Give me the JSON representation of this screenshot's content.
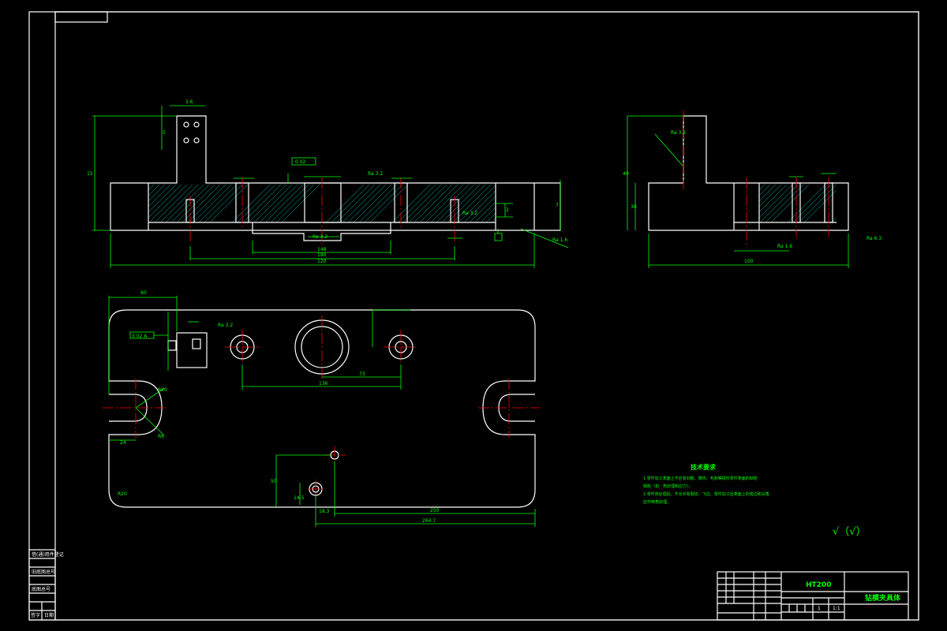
{
  "front_view": {
    "dim_width": "1.6",
    "dim_height": "15",
    "dim_left": "5",
    "dim_right": "7",
    "dim_total_top": "120",
    "dim_center_bottom": "180",
    "dim_mid_bottom": "148",
    "dim_gap": "2",
    "roughness_labels": [
      "Ra 3.2",
      "Ra 3.2",
      "Ra 3.2",
      "Ra 1.6"
    ],
    "tolerance_frame": "0.02"
  },
  "side_view": {
    "dim_total": "100",
    "dim_height": "40",
    "dim_depth": "30",
    "roughness_labels": [
      "Ra 1.6",
      "Ra 3.2",
      "Ra 6.3"
    ]
  },
  "plan_view": {
    "dim_top_left": "60",
    "dim_center_right": "73",
    "dim_center": "136",
    "dim_bottom": "250",
    "dim_bottom_total": "264.7",
    "dim_radius_1": "R20",
    "dim_radius_2": "R6",
    "dim_corner": "R20",
    "dim_slot": "24",
    "dim_vertical": "50",
    "dim_small": "18.3",
    "dim_pin": "14.5",
    "roughness_label": "Ra 3.2",
    "tolerance_frame": "0.02 A"
  },
  "technical_requirements": {
    "title": "技术要求",
    "lines": [
      "1.零件加工表面上不应有划痕、擦伤、毛刺等损伤零件表面的缺陷",
      "缺陷（如：热处理和应力）；",
      "2.零件热处理后，不允许有裂纹、飞边、零件加工后表面上的锐边和尖角",
      "应作倒角处理。"
    ]
  },
  "roughness_symbol": "√（√）",
  "title_block": {
    "material": "HT200",
    "part_name": "钻模夹具体",
    "scale": "1:1",
    "qty": "1"
  },
  "side_panel": {
    "rows": [
      "借(通)用件登记",
      "",
      "旧底图总号",
      "",
      "底图总号",
      "",
      "签字",
      "日期"
    ]
  }
}
